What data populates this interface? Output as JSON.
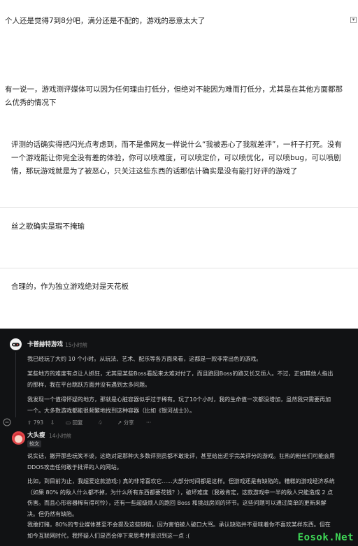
{
  "light_comments": [
    {
      "text": "个人还是觉得7到8分吧，满分还是不配的，游戏的恶意太大了"
    },
    {
      "text": "有一说一，游戏测评媒体可以因为任何理由打低分，但绝对不能因为难而打低分，尤其是在其他方面都那么优秀的情况下"
    },
    {
      "text": "评测的话确实得把闪光点考虑到，而不是像网友一样说什么“我被恶心了我就差评”，一杆子打死。没有一个游戏能让你完全没有差的体验，你可以喷难度，可以喷定价，可以喷优化，可以喷bug，可以喷剧情，那玩游戏就是为了被恶心，只关注这些东西的话那估计确实是没有能打好评的游戏了"
    },
    {
      "text": "丝之歌确实是瑕不掩瑜"
    },
    {
      "text": "合理的，作为独立游戏绝对是天花板"
    }
  ],
  "dark_thread": {
    "comment1": {
      "username": "卡普赫特游戏",
      "time": "15小时前",
      "paragraphs": [
        "我已经玩了大约 10 个小时。从玩法、艺术、配乐等各方面来看，这都是一款非常出色的游戏。",
        "某些地方的难度有点让人抓狂，尤其是某些Boss看起来太难对付了，而且跑回Boss的路又长又烦人。不过，正如其他人指出的那样，我在平台跳跃方面并没有遇到太多问题。",
        "我发现一个值得怀疑的地方，那就是心脏容器似乎过于稀有。玩了10个小时，我的生命值一次都没增加，虽然我只需要再加一个。大多数游戏都能很频繁地找到这种容器（比如《银河战士》）。"
      ],
      "actions": {
        "upvotes": "793",
        "reply": "回复",
        "share": "分享",
        "more": "···"
      }
    },
    "comment2": {
      "username": "大头瘦",
      "time": "14小时前",
      "badge": "较文",
      "paragraphs": [
        "说实话，撇开那些玩笑不谈，这绝对是那种大多数评测员都不敢批评，甚至给出近乎完美评分的游戏。狂热的粉丝们可能会用DDOS攻击任何敢于批评的人的网站。",
        "比如，到目前为止，我超爱这款游戏:) 真的非常喜欢它......大部分时间都是这样。但游戏还是有缺陷的。糟糕的游戏经济系统（如果 80% 的敌人什么都不掉，为什么所有东西都要花钱？），破坏难度（我敢肯定，这款游戏中一半的敌人只能造成 2 点伤害。而且心形容器稀有得可怜），还有一些超级烦人的跑回 Boss 和挑战房间的环节。这些问题可以通过简单的更新来解决。但仍然有缺陷。",
        "我敢打赌，80%的专业媒体甚至不会提及这些缺陷，因为害怕被人破口大骂。承认缺陷并不意味着你不喜欢某样东西。但在如今互联网时代，我怀疑人们是否会停下来思考并意识到这一点 :("
      ]
    }
  },
  "watermark": "Eosok.Net",
  "colors": {
    "dark_bg": "#111214",
    "watermark": "#3fd957",
    "accent_red": "#e0464a"
  }
}
